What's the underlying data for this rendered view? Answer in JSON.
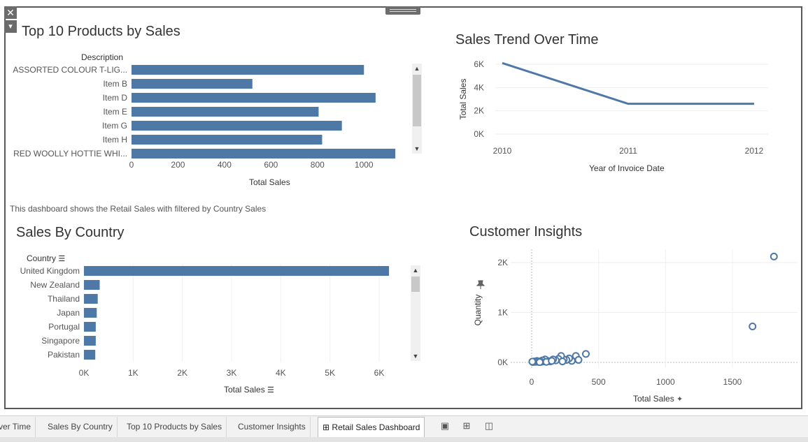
{
  "controls": {
    "close": "✕",
    "menu": "▾"
  },
  "top_products": {
    "title": "Top 10 Products by Sales",
    "column_header": "Description",
    "x_axis_title": "Total Sales",
    "x_ticks": [
      "0",
      "200",
      "400",
      "600",
      "800",
      "1000"
    ],
    "scroll_up": "⌃",
    "scroll_down": "⌄"
  },
  "trend": {
    "title": "Sales Trend Over Time",
    "y_axis_title": "Total Sales",
    "x_axis_title": "Year of Invoice Date",
    "y_ticks": [
      "6K",
      "4K",
      "2K",
      "0K"
    ],
    "x_ticks": [
      "2010",
      "2011",
      "2012"
    ]
  },
  "description_text": "This dashboard shows the Retail Sales with filtered by Country Sales",
  "country": {
    "title": "Sales By Country",
    "column_header": "Country",
    "x_axis_title": "Total Sales",
    "x_ticks": [
      "0K",
      "1K",
      "2K",
      "3K",
      "4K",
      "5K",
      "6K"
    ]
  },
  "insights": {
    "title": "Customer Insights",
    "y_axis_title": "Quantity",
    "x_axis_title": "Total Sales",
    "y_ticks": [
      "2K",
      "1K",
      "0K"
    ],
    "x_ticks": [
      "0",
      "500",
      "1000",
      "1500"
    ]
  },
  "tabs": [
    {
      "label": "ver Time"
    },
    {
      "label": "Sales By Country"
    },
    {
      "label": "Top 10 Products by Sales"
    },
    {
      "label": "Customer Insights"
    },
    {
      "label": "Retail Sales Dashboard"
    }
  ],
  "chart_data": [
    {
      "type": "bar",
      "title": "Top 10 Products by Sales",
      "xlabel": "Total Sales",
      "ylabel": "Description",
      "xlim": [
        0,
        1240
      ],
      "categories": [
        "ASSORTED COLOUR T-LIG...",
        "Item B",
        "Item D",
        "Item E",
        "Item G",
        "Item H",
        "RED WOOLLY HOTTIE WHI..."
      ],
      "values": [
        1000,
        520,
        1050,
        805,
        905,
        820,
        1135
      ],
      "color": "#4e79a7"
    },
    {
      "type": "line",
      "title": "Sales Trend Over Time",
      "xlabel": "Year of Invoice Date",
      "ylabel": "Total Sales",
      "x": [
        "2010",
        "2011",
        "2012"
      ],
      "values": [
        6100,
        2600,
        2600
      ],
      "ylim": [
        0,
        6000
      ],
      "color": "#4e79a7"
    },
    {
      "type": "bar",
      "title": "Sales By Country",
      "xlabel": "Total Sales",
      "ylabel": "Country",
      "xlim": [
        0,
        6600
      ],
      "categories": [
        "United Kingdom",
        "New Zealand",
        "Thailand",
        "Japan",
        "Portugal",
        "Singapore",
        "Pakistan"
      ],
      "values": [
        6200,
        320,
        280,
        260,
        240,
        240,
        230
      ],
      "color": "#4e79a7"
    },
    {
      "type": "scatter",
      "title": "Customer Insights",
      "xlabel": "Total Sales",
      "ylabel": "Quantity",
      "xlim": [
        -100,
        1940
      ],
      "ylim": [
        -30,
        2270
      ],
      "points": [
        [
          1810,
          2120
        ],
        [
          1650,
          720
        ],
        [
          405,
          170
        ],
        [
          330,
          130
        ],
        [
          350,
          50
        ],
        [
          300,
          30
        ],
        [
          280,
          80
        ],
        [
          260,
          50
        ],
        [
          240,
          60
        ],
        [
          220,
          130
        ],
        [
          200,
          70
        ],
        [
          180,
          40
        ],
        [
          160,
          60
        ],
        [
          140,
          20
        ],
        [
          120,
          30
        ],
        [
          100,
          60
        ],
        [
          90,
          20
        ],
        [
          80,
          40
        ],
        [
          70,
          10
        ],
        [
          60,
          20
        ],
        [
          50,
          10
        ],
        [
          40,
          30
        ],
        [
          30,
          10
        ],
        [
          20,
          20
        ],
        [
          10,
          5
        ],
        [
          5,
          15
        ],
        [
          60,
          5
        ],
        [
          110,
          10
        ],
        [
          150,
          30
        ],
        [
          230,
          20
        ]
      ],
      "color": "#4e79a7"
    }
  ]
}
